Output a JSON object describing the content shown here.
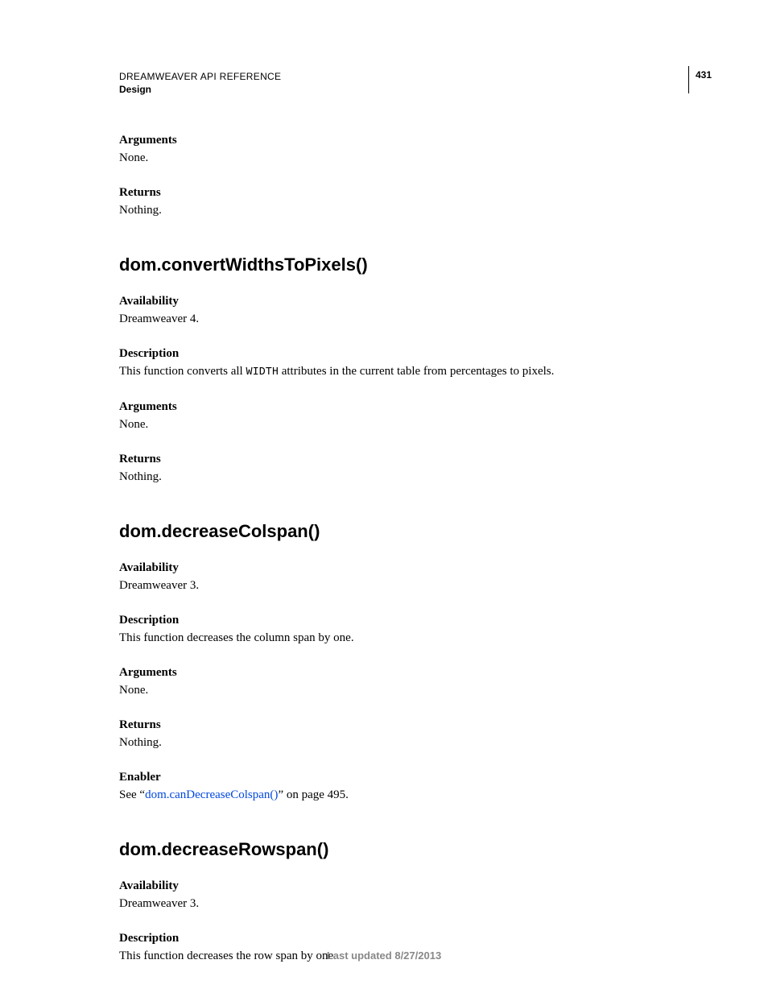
{
  "header": {
    "doc_title": "DREAMWEAVER API REFERENCE",
    "section": "Design",
    "page_number": "431"
  },
  "intro": {
    "arguments_label": "Arguments",
    "arguments_value": "None.",
    "returns_label": "Returns",
    "returns_value": "Nothing."
  },
  "method1": {
    "heading": "dom.convertWidthsToPixels()",
    "availability_label": "Availability",
    "availability_value": "Dreamweaver 4.",
    "description_label": "Description",
    "description_pre": "This function converts all ",
    "description_code": "WIDTH",
    "description_post": " attributes in the current table from percentages to pixels.",
    "arguments_label": "Arguments",
    "arguments_value": "None.",
    "returns_label": "Returns",
    "returns_value": "Nothing."
  },
  "method2": {
    "heading": "dom.decreaseColspan()",
    "availability_label": "Availability",
    "availability_value": "Dreamweaver 3.",
    "description_label": "Description",
    "description_value": "This function decreases the column span by one.",
    "arguments_label": "Arguments",
    "arguments_value": "None.",
    "returns_label": "Returns",
    "returns_value": "Nothing.",
    "enabler_label": "Enabler",
    "enabler_pre": "See “",
    "enabler_link": "dom.canDecreaseColspan()",
    "enabler_post": "” on page 495."
  },
  "method3": {
    "heading": "dom.decreaseRowspan()",
    "availability_label": "Availability",
    "availability_value": "Dreamweaver 3.",
    "description_label": "Description",
    "description_value": "This function decreases the row span by one."
  },
  "footer": {
    "text": "Last updated 8/27/2013"
  }
}
